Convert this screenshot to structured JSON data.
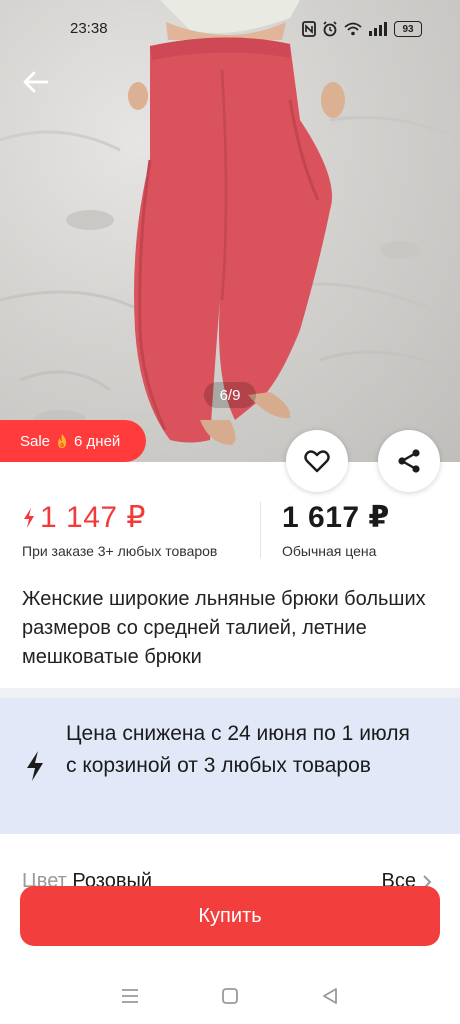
{
  "status_bar": {
    "time": "23:38",
    "battery": "93",
    "icons": [
      "nfc-icon",
      "alarm-icon",
      "wifi-icon",
      "signal-icon",
      "battery-icon"
    ]
  },
  "gallery": {
    "counter": "6/9",
    "current_index": 6,
    "total": 9
  },
  "sale_badge": {
    "label": "Sale",
    "icon": "fire-icon",
    "duration": "6 дней"
  },
  "prices": {
    "sale_value": "1 147 ₽",
    "sale_note": "При заказе 3+ любых товаров",
    "regular_value": "1 617 ₽",
    "regular_note": "Обычная цена"
  },
  "product": {
    "title": "Женские широкие льняные брюки больших размеров со средней талией, летние мешковатые брюки"
  },
  "promo": {
    "text": "Цена снижена с 24 июня по 1 июля с корзиной от 3 любых товаров"
  },
  "options": {
    "color_label": "Цвет",
    "color_value": "Розовый",
    "all_label": "Все"
  },
  "actions": {
    "buy_label": "Купить"
  },
  "colors": {
    "accent": "#f33e3e",
    "sale_price": "#f23a3a",
    "promo_bg": "#e2e8f8",
    "pants": "#d9525c"
  }
}
